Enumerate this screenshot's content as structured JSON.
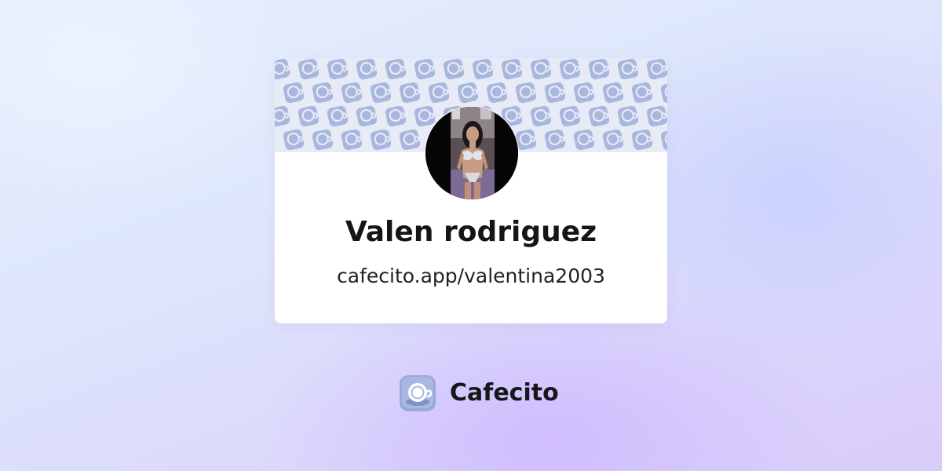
{
  "profile": {
    "name": "Valen rodriguez",
    "url": "cafecito.app/valentina2003"
  },
  "brand": {
    "name": "Cafecito",
    "logo_icon": "cafecito-cup-icon"
  },
  "banner": {
    "pattern_icon": "coffee-cup-icon",
    "color": "#a9b6de"
  },
  "colors": {
    "card_background": "#ffffff",
    "banner_background": "#e6ebf6",
    "logo": "#9aa9d8",
    "text": "#151515"
  }
}
